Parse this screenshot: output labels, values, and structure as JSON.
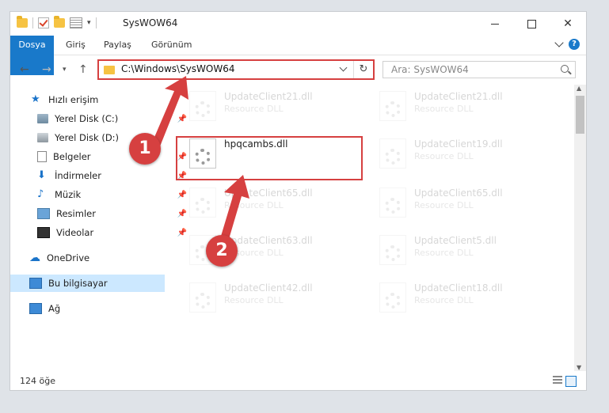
{
  "window": {
    "title": "SysWOW64"
  },
  "ribbon": {
    "tabs": [
      "Dosya",
      "Giriş",
      "Paylaş",
      "Görünüm"
    ],
    "help": "?"
  },
  "address": {
    "path": "C:\\Windows\\SysWOW64"
  },
  "search": {
    "placeholder": "Ara: SysWOW64"
  },
  "sidebar": {
    "items": [
      {
        "label": "Hızlı erişim",
        "icon": "star-icon"
      },
      {
        "label": "Yerel Disk (C:)",
        "icon": "drive-icon",
        "pinned": true
      },
      {
        "label": "Yerel Disk (D:)",
        "icon": "drive-icon"
      },
      {
        "label": "Belgeler",
        "icon": "documents-icon",
        "pinned": true
      },
      {
        "label": "İndirmeler",
        "icon": "download-icon",
        "pinned": true
      },
      {
        "label": "Müzik",
        "icon": "music-icon",
        "pinned": true
      },
      {
        "label": "Resimler",
        "icon": "pictures-icon",
        "pinned": true
      },
      {
        "label": "Videolar",
        "icon": "videos-icon",
        "pinned": true
      },
      {
        "label": "OneDrive",
        "icon": "cloud-icon"
      },
      {
        "label": "Bu bilgisayar",
        "icon": "computer-icon",
        "selected": true
      },
      {
        "label": "Ağ",
        "icon": "network-icon"
      }
    ]
  },
  "files": [
    {
      "name": "UpdateClient21.dll",
      "desc": "Resource DLL"
    },
    {
      "name": "UpdateClient21.dll",
      "desc": "Resource DLL"
    },
    {
      "name": "hpqcambs.dll",
      "desc": ""
    },
    {
      "name": "UpdateClient19.dll",
      "desc": "Resource DLL"
    },
    {
      "name": "UpdateClient65.dll",
      "desc": "Resource DLL"
    },
    {
      "name": "UpdateClient65.dll",
      "desc": "Resource DLL"
    },
    {
      "name": "UpdateClient63.dll",
      "desc": "Resource DLL"
    },
    {
      "name": "UpdateClient5.dll",
      "desc": "Resource DLL"
    },
    {
      "name": "UpdateClient42.dll",
      "desc": "Resource DLL"
    },
    {
      "name": "UpdateClient18.dll",
      "desc": "Resource DLL"
    }
  ],
  "status": {
    "count": "124 öğe"
  },
  "annotations": {
    "badge1": "1",
    "badge2": "2",
    "color": "#d64040"
  }
}
